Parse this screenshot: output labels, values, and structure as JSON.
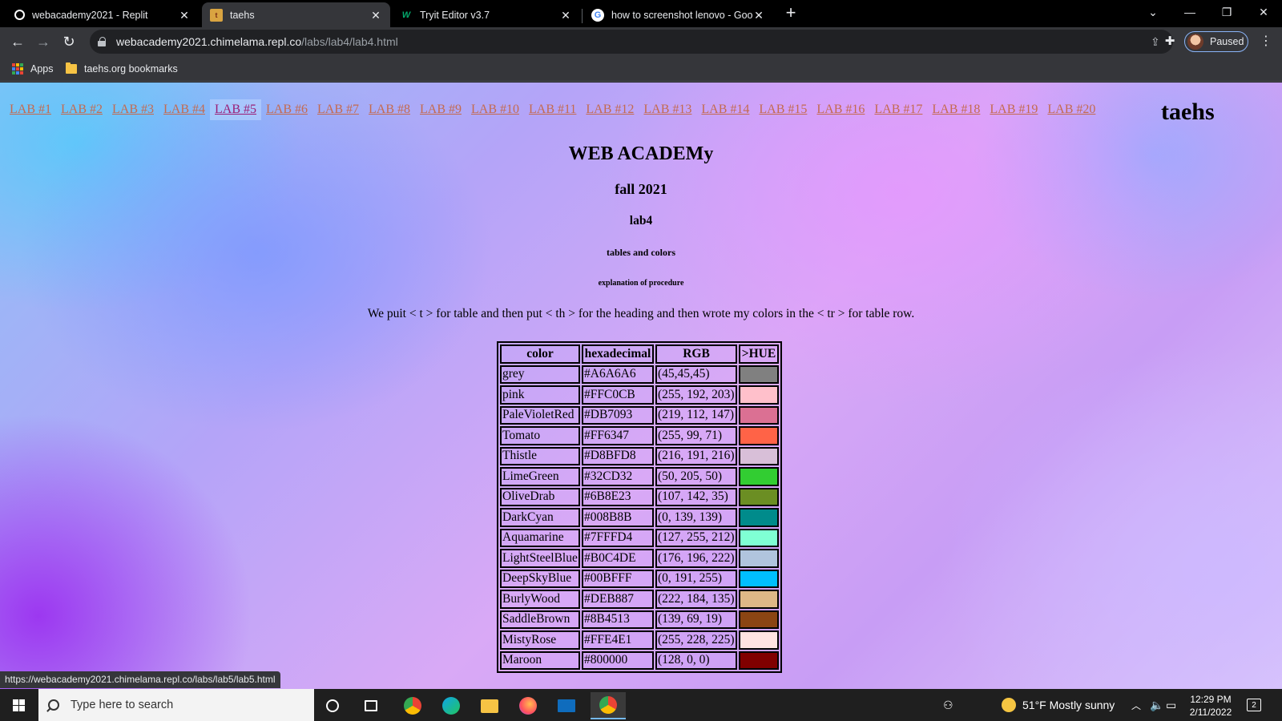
{
  "browser": {
    "tabs": [
      {
        "title": "webacademy2021 - Replit",
        "favicon": "replit-icon"
      },
      {
        "title": "taehs",
        "favicon": "taehs-icon"
      },
      {
        "title": "Tryit Editor v3.7",
        "favicon": "w3schools-icon"
      },
      {
        "title": "how to screenshot lenovo - Goog",
        "favicon": "google-icon"
      }
    ],
    "active_tab": 1,
    "url_host": "webacademy2021.chimelama.repl.co",
    "url_path": "/labs/lab4/lab4.html",
    "profile_label": "Paused",
    "bookmarks": [
      {
        "label": "Apps",
        "icon": "apps-grid-icon"
      },
      {
        "label": "taehs.org bookmarks",
        "icon": "folder-icon"
      }
    ],
    "status_url": "https://webacademy2021.chimelama.repl.co/labs/lab5/lab5.html"
  },
  "page": {
    "labs": [
      "LAB #1",
      "LAB #2",
      "LAB #3",
      "LAB #4",
      "LAB #5",
      "LAB #6",
      "LAB #7",
      "LAB #8",
      "LAB #9",
      "LAB #10",
      "LAB #11",
      "LAB #12",
      "LAB #13",
      "LAB #14",
      "LAB #15",
      "LAB #16",
      "LAB #17",
      "LAB #18",
      "LAB #19",
      "LAB #20"
    ],
    "hovered_lab": 4,
    "brand": "taehs",
    "title": "WEB ACADEMy",
    "term": "fall 2021",
    "lab": "lab4",
    "topic": "tables and colors",
    "section": "explanation of procedure",
    "paragraph": "We puit < t > for table and then put < th > for the heading and then wrote my colors in the < tr > for table row.",
    "table": {
      "headers": [
        "color",
        "hexadecimal",
        "RGB",
        ">HUE"
      ],
      "rows": [
        {
          "name": "grey",
          "hex": "#A6A6A6",
          "rgb": "(45,45,45)",
          "swatch": "#808080"
        },
        {
          "name": "pink",
          "hex": "#FFC0CB",
          "rgb": "(255, 192, 203)",
          "swatch": "#FFC0CB"
        },
        {
          "name": "PaleVioletRed",
          "hex": "#DB7093",
          "rgb": "(219, 112, 147)",
          "swatch": "#DB7093"
        },
        {
          "name": "Tomato",
          "hex": "#FF6347",
          "rgb": "(255, 99, 71)",
          "swatch": "#FF6347"
        },
        {
          "name": "Thistle",
          "hex": "#D8BFD8",
          "rgb": "(216, 191, 216)",
          "swatch": "#D8BFD8"
        },
        {
          "name": "LimeGreen",
          "hex": "#32CD32",
          "rgb": "(50, 205, 50)",
          "swatch": "#32CD32"
        },
        {
          "name": "OliveDrab",
          "hex": "#6B8E23",
          "rgb": "(107, 142, 35)",
          "swatch": "#6B8E23"
        },
        {
          "name": "DarkCyan",
          "hex": "#008B8B",
          "rgb": "(0, 139, 139)",
          "swatch": "#008B8B"
        },
        {
          "name": "Aquamarine",
          "hex": "#7FFFD4",
          "rgb": "(127, 255, 212)",
          "swatch": "#7FFFD4"
        },
        {
          "name": "LightSteelBlue",
          "hex": "#B0C4DE",
          "rgb": "(176, 196, 222)",
          "swatch": "#B0C4DE"
        },
        {
          "name": "DeepSkyBlue",
          "hex": "#00BFFF",
          "rgb": "(0, 191, 255)",
          "swatch": "#00BFFF"
        },
        {
          "name": "BurlyWood",
          "hex": "#DEB887",
          "rgb": "(222, 184, 135)",
          "swatch": "#DEB887"
        },
        {
          "name": "SaddleBrown",
          "hex": "#8B4513",
          "rgb": "(139, 69, 19)",
          "swatch": "#8B4513"
        },
        {
          "name": "MistyRose",
          "hex": "#FFE4E1",
          "rgb": "(255, 228, 225)",
          "swatch": "#FFE4E1"
        },
        {
          "name": "Maroon",
          "hex": "#800000",
          "rgb": "(128, 0, 0)",
          "swatch": "#800000"
        }
      ]
    }
  },
  "taskbar": {
    "search_placeholder": "Type here to search",
    "weather": "51°F  Mostly sunny",
    "time": "12:29 PM",
    "date": "2/11/2022",
    "notifications": "2",
    "apps": [
      "cortana-icon",
      "task-view-icon",
      "chrome-icon",
      "edge-icon",
      "file-explorer-icon",
      "firefox-icon",
      "mail-icon",
      "chrome-profile-icon"
    ]
  },
  "colors": {
    "link": "#c46a4f",
    "link_hover": "#9b1d75",
    "chrome_dark": "#35363a",
    "accent": "#8ab4f8"
  }
}
